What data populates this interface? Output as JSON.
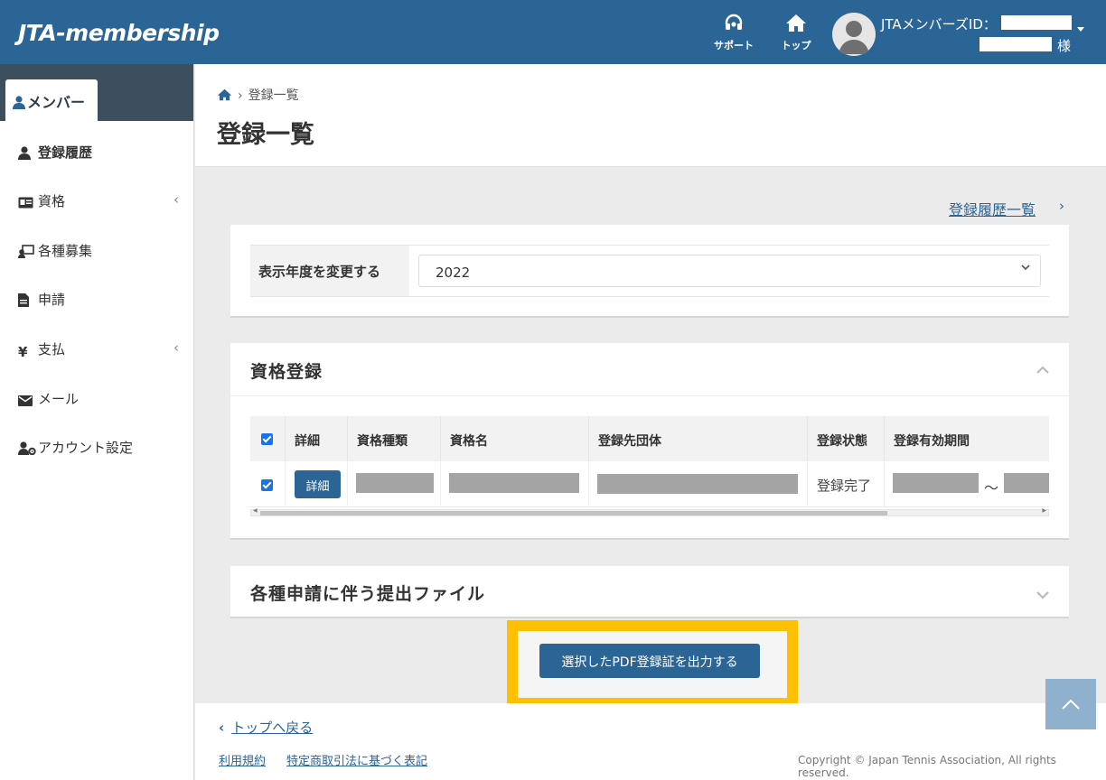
{
  "header": {
    "logo": "JTA-membership",
    "support_label": "サポート",
    "top_label": "トップ",
    "member_id_label": "JTAメンバーズID：",
    "honorific": "様"
  },
  "sidebar": {
    "section_tab": "メンバー",
    "items": [
      {
        "label": "登録履歴",
        "icon": "user-icon",
        "active": true
      },
      {
        "label": "資格",
        "icon": "id-card-icon",
        "has_submenu": true
      },
      {
        "label": "各種募集",
        "icon": "recruit-icon"
      },
      {
        "label": "申請",
        "icon": "document-icon"
      },
      {
        "label": "支払",
        "icon": "yen-icon",
        "has_submenu": true
      },
      {
        "label": "メール",
        "icon": "mail-icon"
      },
      {
        "label": "アカウント設定",
        "icon": "user-gear-icon"
      }
    ]
  },
  "breadcrumb": {
    "current": "登録一覧"
  },
  "page_title": "登録一覧",
  "history_link": "登録履歴一覧",
  "year_filter": {
    "label": "表示年度を変更する",
    "selected": "2022"
  },
  "qualification_card": {
    "title": "資格登録",
    "columns": [
      "詳細",
      "資格種類",
      "資格名",
      "登録先団体",
      "登録状態",
      "登録有効期間"
    ],
    "rows": [
      {
        "checked": true,
        "detail_button": "詳細",
        "status": "登録完了",
        "period_separator": "～"
      }
    ]
  },
  "files_card": {
    "title": "各種申請に伴う提出ファイル"
  },
  "pdf_button": "選択したPDF登録証を出力する",
  "footer": {
    "back_link": "トップへ戻る",
    "terms_link": "利用規約",
    "law_link": "特定商取引法に基づく表記",
    "copyright": "Copyright © Japan Tennis Association, All rights reserved."
  },
  "colors": {
    "brand": "#2b6596",
    "highlight": "#ffc000",
    "sidebar_head": "#3d4f5e"
  }
}
